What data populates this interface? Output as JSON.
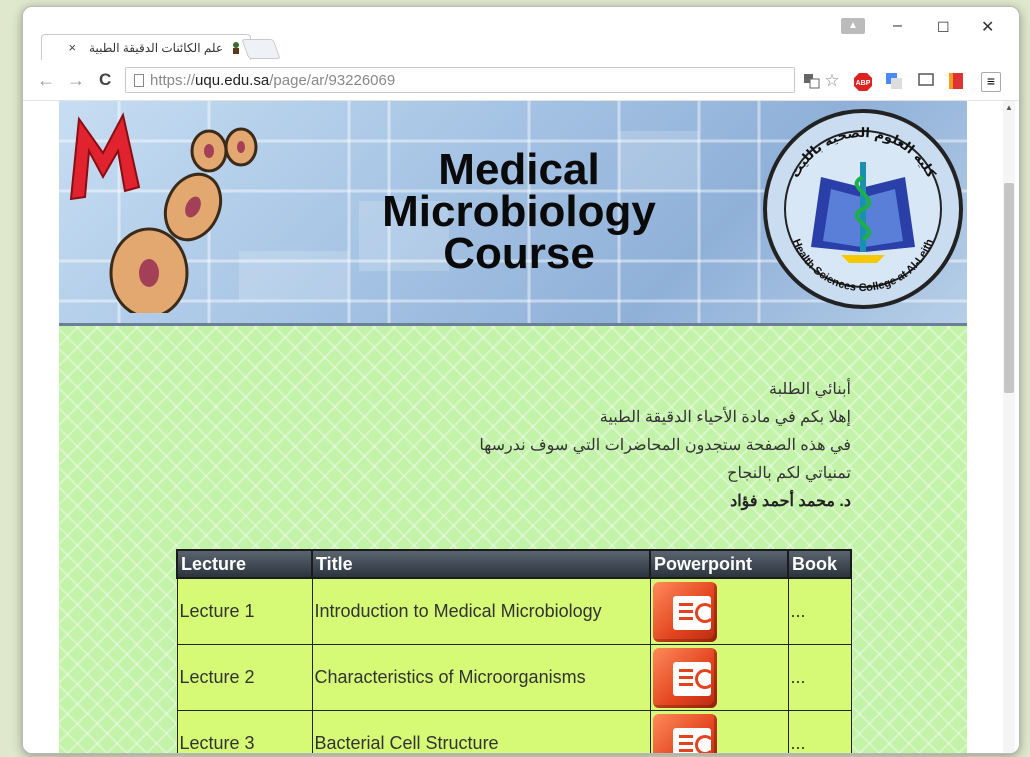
{
  "browser": {
    "tab_title": "علم الكائنات الدقيقة الطبية",
    "tab_close": "×",
    "url_protocol": "https://",
    "url_host": "uqu.edu.sa",
    "url_path": "/page/ar/93226069",
    "window_min": "–",
    "window_max": "☐",
    "window_close": "✕",
    "abp_label": "ABP"
  },
  "banner": {
    "title_line1": "Medical",
    "title_line2": "Microbiology",
    "title_line3": "Course",
    "logo_text_top": "كلية العلوم الصحية بالليث",
    "logo_text_bottom": "Health Sciences College at Al-Leith"
  },
  "intro": {
    "line1": "أبنائي الطلبة",
    "line2": "إهلا بكم في مادة الأحياء الدقيقة الطبية",
    "line3": "في هذه الصفحة ستجدون المحاضرات التي سوف ندرسها",
    "line4": "تمنياتي لكم بالنجاح",
    "signature": "د. محمد أحمد فؤاد"
  },
  "table": {
    "headers": [
      "Lecture",
      "Title",
      "Powerpoint",
      "Book"
    ],
    "rows": [
      {
        "lecture": "Lecture 1",
        "title": "Introduction to Medical Microbiology",
        "book": "..."
      },
      {
        "lecture": "Lecture 2",
        "title": "Characteristics of Microorganisms",
        "book": "..."
      },
      {
        "lecture": "Lecture 3",
        "title": "Bacterial Cell Structure",
        "book": "..."
      }
    ]
  },
  "colors": {
    "page_green": "#c3f2a9",
    "table_row": "#d6f976",
    "table_header": "#3a434c",
    "ppt_orange": "#e2421e"
  }
}
